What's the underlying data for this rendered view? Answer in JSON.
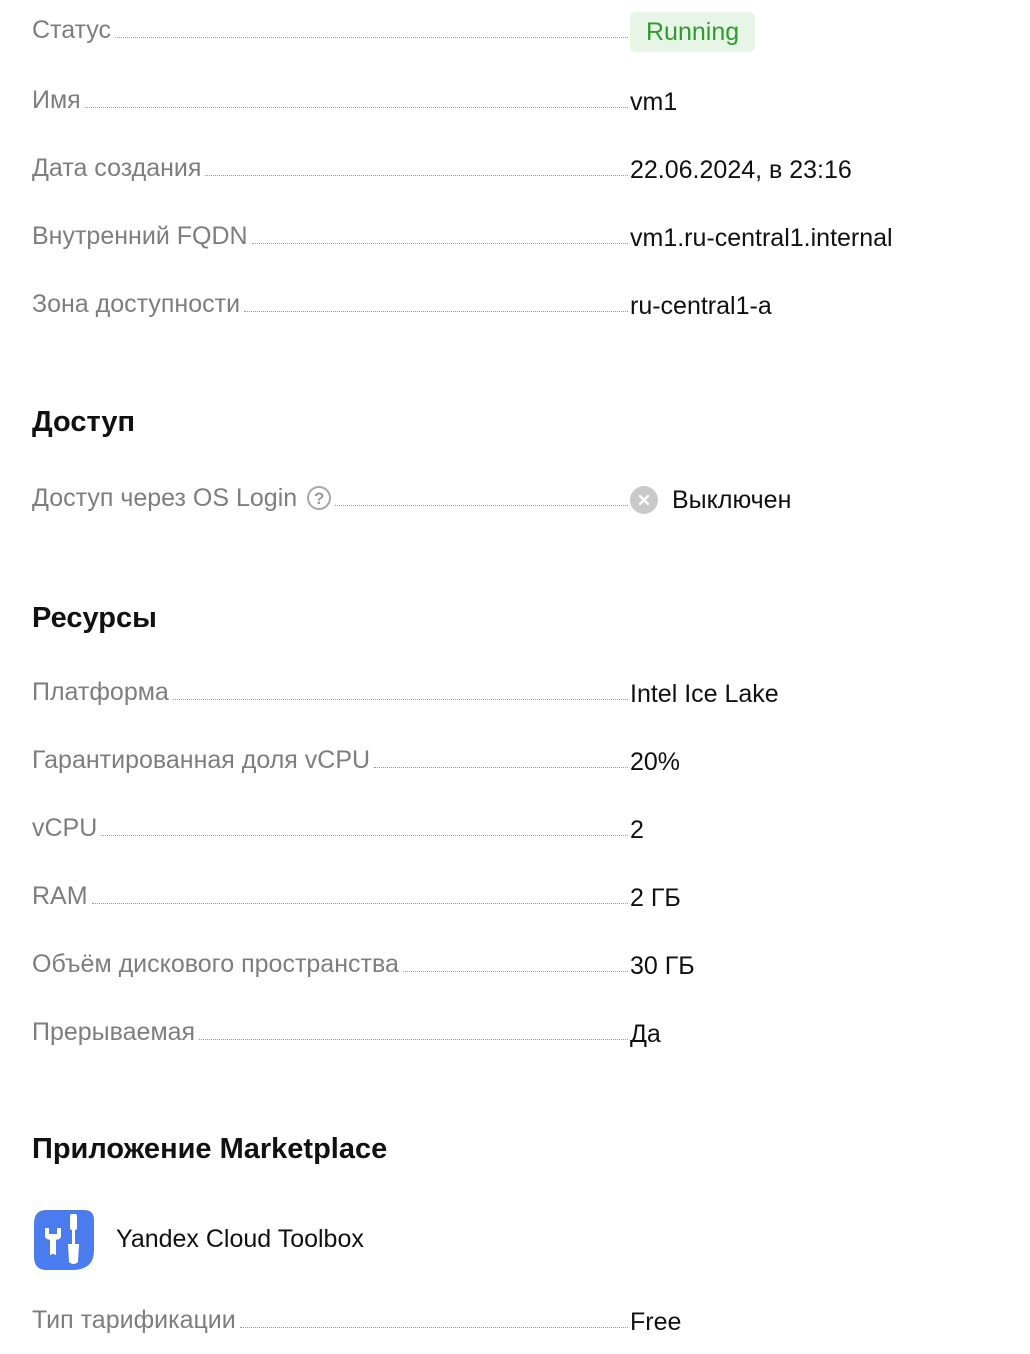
{
  "general": {
    "status_label": "Статус",
    "status_value": "Running",
    "name_label": "Имя",
    "name_value": "vm1",
    "created_label": "Дата создания",
    "created_value": "22.06.2024, в 23:16",
    "fqdn_label": "Внутренний FQDN",
    "fqdn_value": "vm1.ru-central1.internal",
    "zone_label": "Зона доступности",
    "zone_value": "ru-central1-a"
  },
  "access": {
    "title": "Доступ",
    "oslogin_label": "Доступ через OS Login",
    "oslogin_value": "Выключен",
    "help_glyph": "?"
  },
  "resources": {
    "title": "Ресурсы",
    "platform_label": "Платформа",
    "platform_value": "Intel Ice Lake",
    "vcpu_share_label": "Гарантированная доля vCPU",
    "vcpu_share_value": "20%",
    "vcpu_label": "vCPU",
    "vcpu_value": "2",
    "ram_label": "RAM",
    "ram_value": "2 ГБ",
    "disk_label": "Объём дискового пространства",
    "disk_value": "30 ГБ",
    "preemptible_label": "Прерываемая",
    "preemptible_value": "Да"
  },
  "marketplace": {
    "title": "Приложение Marketplace",
    "app_name": "Yandex Cloud Toolbox",
    "app_icon": "toolbox-logo-icon",
    "billing_label": "Тип тарификации",
    "billing_value": "Free"
  },
  "colors": {
    "status_bg": "#e6f5e6",
    "status_text": "#2f9b2f",
    "label_text": "#7e7e7e",
    "logo_blue": "#4a7cf0"
  }
}
